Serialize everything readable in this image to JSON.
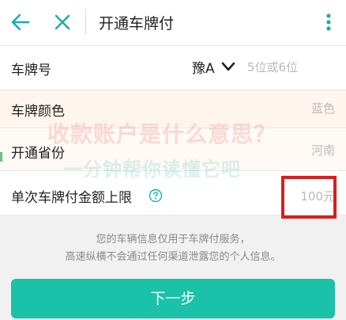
{
  "header": {
    "title": "开通车牌付",
    "back_icon": "arrow-left-icon",
    "close_icon": "close-icon",
    "more_icon": "more-vertical-icon",
    "icon_color": "#1fa9b3"
  },
  "form": {
    "plate": {
      "label": "车牌号",
      "province_value": "豫A",
      "placeholder": "5位或6位"
    },
    "color": {
      "label": "车牌颜色",
      "value": "蓝色"
    },
    "province": {
      "label": "开通省份",
      "value": "河南"
    },
    "limit": {
      "label": "单次车牌付金额上限",
      "value": "100元",
      "help_icon": "question-circle-icon"
    }
  },
  "watermark": {
    "line1": "收款账户是什么意思？",
    "line2": "一分钟帮你读懂它吧"
  },
  "notice": {
    "line1": "您的车辆信息仅用于车牌付服务，",
    "line2": "高速纵横不会通过任何渠道泄露您的个人信息。"
  },
  "actions": {
    "next_label": "下一步",
    "primary_color": "#19c2a9"
  },
  "highlight_color": "#d81e1e"
}
